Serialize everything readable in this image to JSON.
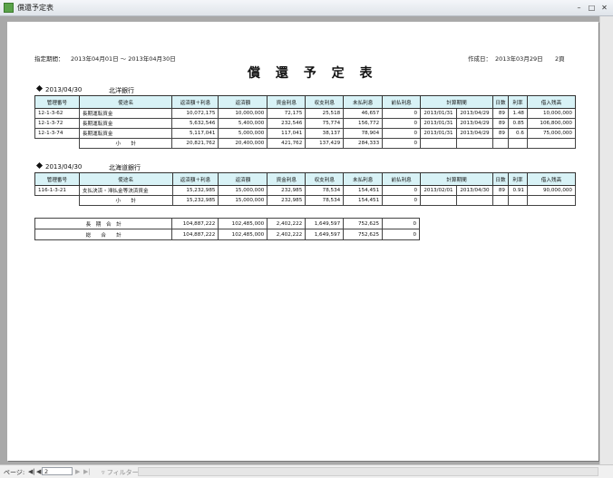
{
  "window": {
    "title": "償還予定表"
  },
  "report": {
    "period_label": "指定期間：",
    "period_value": "2013年04月01日 〜 2013年04月30日",
    "title": "償 還 予 定 表",
    "created_label": "作成日：",
    "created_value": "2013年03月29日",
    "page": "2頁"
  },
  "columns": [
    "管理番号",
    "使途名",
    "返済額＋利息",
    "返済額",
    "資金利息",
    "収支利息",
    "未払利息",
    "前払利息",
    "計算期間",
    "日数",
    "利率",
    "借入残高"
  ],
  "sections": [
    {
      "date": "2013/04/30",
      "bank": "北洋銀行",
      "rows": [
        [
          "12-1-3-62",
          "長期運転資金",
          "10,072,175",
          "10,000,000",
          "72,175",
          "25,518",
          "46,657",
          "0",
          "2013/01/31",
          "2013/04/29",
          "89",
          "1.48",
          "10,000,000"
        ],
        [
          "12-1-3-72",
          "長期運転資金",
          "5,632,546",
          "5,400,000",
          "232,546",
          "75,774",
          "156,772",
          "0",
          "2013/01/31",
          "2013/04/29",
          "89",
          "0.85",
          "106,800,000"
        ],
        [
          "12-1-3-74",
          "長期運転資金",
          "5,117,041",
          "5,000,000",
          "117,041",
          "38,137",
          "78,904",
          "0",
          "2013/01/31",
          "2013/04/29",
          "89",
          "0.6",
          "75,000,000"
        ]
      ],
      "subtotal_label": "小　　計",
      "subtotal": [
        "20,821,762",
        "20,400,000",
        "421,762",
        "137,429",
        "284,333",
        "0"
      ]
    },
    {
      "date": "2013/04/30",
      "bank": "北海道銀行",
      "rows": [
        [
          "116-1-3-21",
          "支払決済・滞払金等決済資金",
          "15,232,985",
          "15,000,000",
          "232,985",
          "78,534",
          "154,451",
          "0",
          "2013/02/01",
          "2013/04/30",
          "89",
          "0.91",
          "90,000,000"
        ]
      ],
      "subtotal_label": "小　　計",
      "subtotal": [
        "15,232,985",
        "15,000,000",
        "232,985",
        "78,534",
        "154,451",
        "0"
      ]
    }
  ],
  "totals": [
    {
      "label": "長　期　合　計",
      "values": [
        "104,887,222",
        "102,485,000",
        "2,402,222",
        "1,649,597",
        "752,625",
        "0"
      ]
    },
    {
      "label": "総　　合　　計",
      "values": [
        "104,887,222",
        "102,485,000",
        "2,402,222",
        "1,649,597",
        "752,625",
        "0"
      ]
    }
  ],
  "statusbar": {
    "page_label": "ページ:",
    "page_value": "2",
    "filter_label": "フィルターなし"
  }
}
